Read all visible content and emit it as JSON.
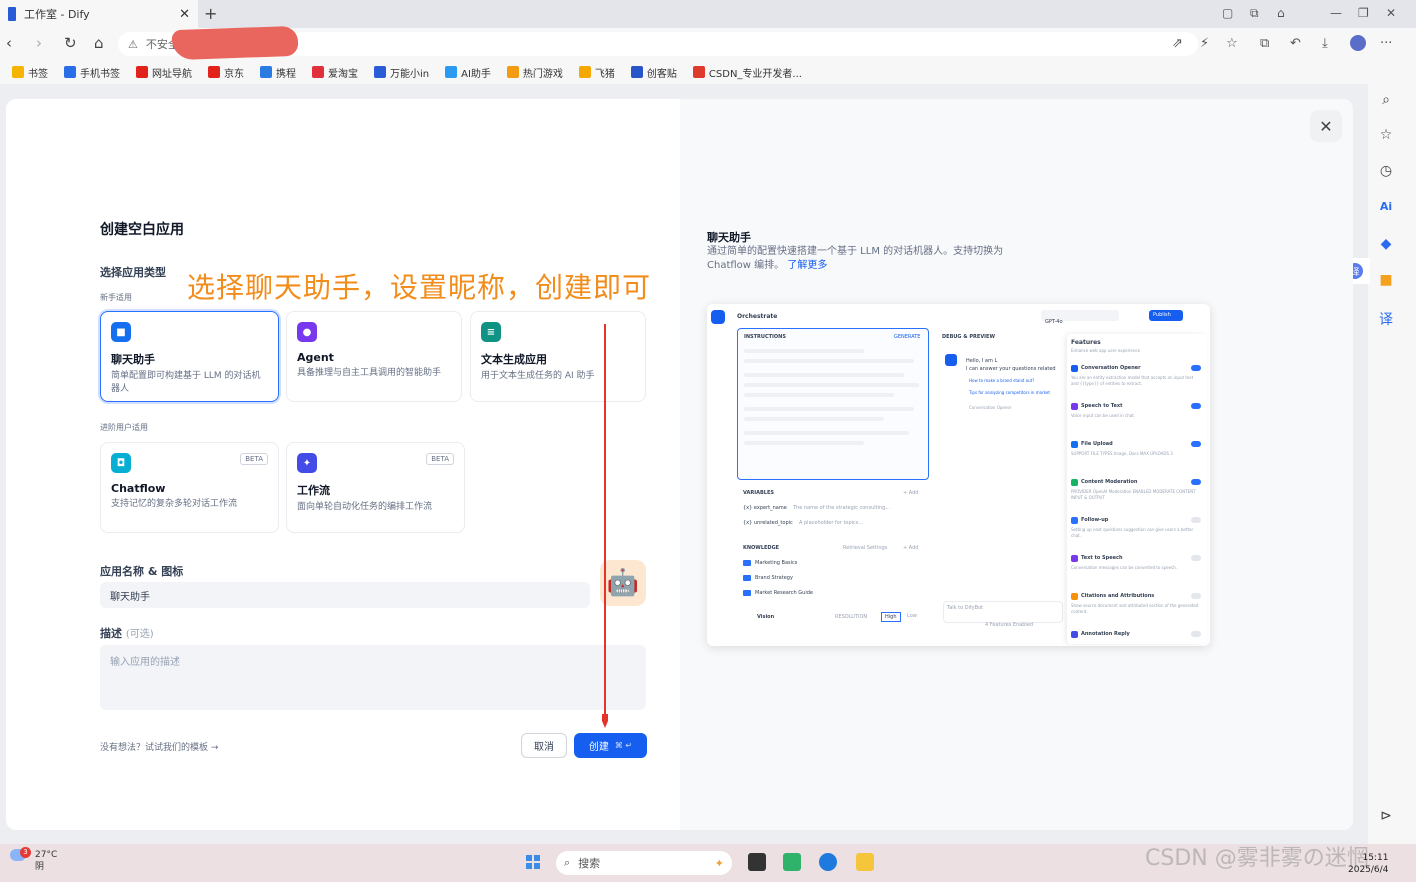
{
  "browser": {
    "tab_title": "工作室 - Dify",
    "url_prefix": "不安全",
    "url_text": "....",
    "bookmarks": [
      "书签",
      "手机书签",
      "网址导航",
      "京东",
      "携程",
      "爱淘宝",
      "万能小in",
      "AI助手",
      "热门游戏",
      "飞猪",
      "创客贴",
      "CSDN_专业开发者..."
    ],
    "bookmark_colors": [
      "#f5b400",
      "#2b6de6",
      "#e2231a",
      "#e2231a",
      "#2a7be4",
      "#e0303a",
      "#2b5bd7",
      "#2b9af3",
      "#f39c12",
      "#f6a800",
      "#2a55c8",
      "#e03a2e"
    ]
  },
  "dialog": {
    "title": "创建空白应用",
    "type_label": "选择应用类型",
    "beginner_label": "新手适用",
    "advanced_label": "进阶用户适用",
    "cards": [
      {
        "name": "聊天助手",
        "desc": "简单配置即可构建基于 LLM 的对话机器人",
        "color": "#1570ef",
        "glyph": "■"
      },
      {
        "name": "Agent",
        "desc": "具备推理与自主工具调用的智能助手",
        "color": "#7839ee",
        "glyph": "●"
      },
      {
        "name": "文本生成应用",
        "desc": "用于文本生成任务的 AI 助手",
        "color": "#0e9384",
        "glyph": "≡"
      },
      {
        "name": "Chatflow",
        "desc": "支持记忆的复杂多轮对话工作流",
        "color": "#06aed4",
        "glyph": "◘",
        "badge": "BETA"
      },
      {
        "name": "工作流",
        "desc": "面向单轮自动化任务的编排工作流",
        "color": "#444ce7",
        "glyph": "✦",
        "badge": "BETA"
      }
    ],
    "name_label": "应用名称 & 图标",
    "name_value": "聊天助手",
    "desc_label": "描述",
    "desc_optional": "(可选)",
    "desc_placeholder": "输入应用的描述",
    "template_hint": "没有想法？试试我们的模板",
    "cancel": "取消",
    "create": "创建",
    "create_keys": "⌘ ↵",
    "annotation": "选择聊天助手，设置昵称，创建即可"
  },
  "preview": {
    "title": "聊天助手",
    "desc": "通过简单的配置快速搭建一个基于 LLM 的对话机器人。支持切换为 Chatflow 编排。",
    "link": "了解更多",
    "shot": {
      "orchestrate": "Orchestrate",
      "model": "GPT-4o",
      "publish": "Publish",
      "instructions": "INSTRUCTIONS",
      "generate": "GENERATE",
      "debug": "DEBUG & PREVIEW",
      "hello": "Hello, I am L",
      "hello2": "I can answer your questions related",
      "q1": "How to make a brand stand out?",
      "q2": "Tips for analyzing competitors in market",
      "conv_opener": "Conversation Opener",
      "edit": "Edit",
      "variables": "VARIABLES",
      "add": "+ Add",
      "var1": "{x} expert_name",
      "var1d": "The name of the strategic consulting...",
      "var2": "{x} unrelated_topic",
      "var2d": "A placeholder for topics...",
      "knowledge": "KNOWLEDGE",
      "retrieval": "Retrieval Settings",
      "k1": "Marketing Basics",
      "k2": "Brand Strategy",
      "k3": "Market Research Guide",
      "vision": "Vision",
      "resolution": "RESOLUTION",
      "high": "High",
      "low": "Low",
      "talk": "Talk to DifyBot",
      "features_enabled": "4 Features Enabled",
      "features": "Features",
      "features_sub": "Enhance web app user experience",
      "f_items": [
        {
          "name": "Conversation Opener",
          "desc": "You are an entity extraction model that accepts an input text and {{type}} of entities to extract.",
          "on": true
        },
        {
          "name": "Speech to Text",
          "desc": "Voice input can be used in chat.",
          "on": true
        },
        {
          "name": "File Upload",
          "desc": "SUPPORT FILE TYPES  Image, Docs   MAX UPLOADS 3",
          "on": true
        },
        {
          "name": "Content Moderation",
          "desc": "PROVIDER OpenAI Moderation   ENABLED MODERATE CONTENT INPUT & OUTPUT",
          "on": true
        },
        {
          "name": "Follow-up",
          "desc": "Setting up next questions suggestion can give users a better chat.",
          "on": false
        },
        {
          "name": "Text to Speech",
          "desc": "Conversation messages can be converted to speech.",
          "on": false
        },
        {
          "name": "Citations and Attributions",
          "desc": "Show source document and attributed section of the generated content.",
          "on": false
        },
        {
          "name": "Annotation Reply",
          "desc": "",
          "on": false
        }
      ]
    }
  },
  "taskbar": {
    "weather_temp": "27°C",
    "weather_desc": "阴",
    "weather_badge": "3",
    "search": "搜索",
    "time": "15:11",
    "date": "2025/6/4",
    "watermark": "CSDN @雾非雾の迷惘"
  }
}
